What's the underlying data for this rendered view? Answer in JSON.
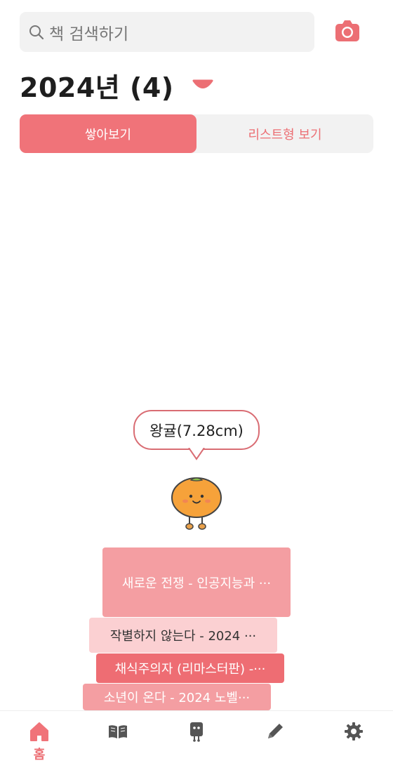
{
  "search": {
    "placeholder": "책 검색하기"
  },
  "header": {
    "year_title": "2024년 (4)"
  },
  "tabs": [
    {
      "label": "쌓아보기",
      "active": true
    },
    {
      "label": "리스트형 보기",
      "active": false
    }
  ],
  "highlight": {
    "bubble_text": "왕귤(7.28cm)"
  },
  "books": [
    {
      "title": "새로운 전쟁 - 인공지능과 ···"
    },
    {
      "title": "작별하지 않는다 - 2024 ···"
    },
    {
      "title": "채식주의자 (리마스터판) -···"
    },
    {
      "title": "소년이 온다 - 2024 노벨···"
    }
  ],
  "bottom_nav": {
    "items": [
      {
        "icon": "home-icon",
        "label": "홈",
        "active": true
      },
      {
        "icon": "open-book-icon",
        "active": false
      },
      {
        "icon": "character-icon",
        "active": false
      },
      {
        "icon": "pencil-icon",
        "active": false
      },
      {
        "icon": "gear-icon",
        "active": false
      }
    ]
  },
  "colors": {
    "accent": "#f07379",
    "accent_light": "#f49ea2",
    "accent_pale": "#fbd0d2",
    "accent_dark": "#ee6d73",
    "icon_gray": "#555555"
  }
}
